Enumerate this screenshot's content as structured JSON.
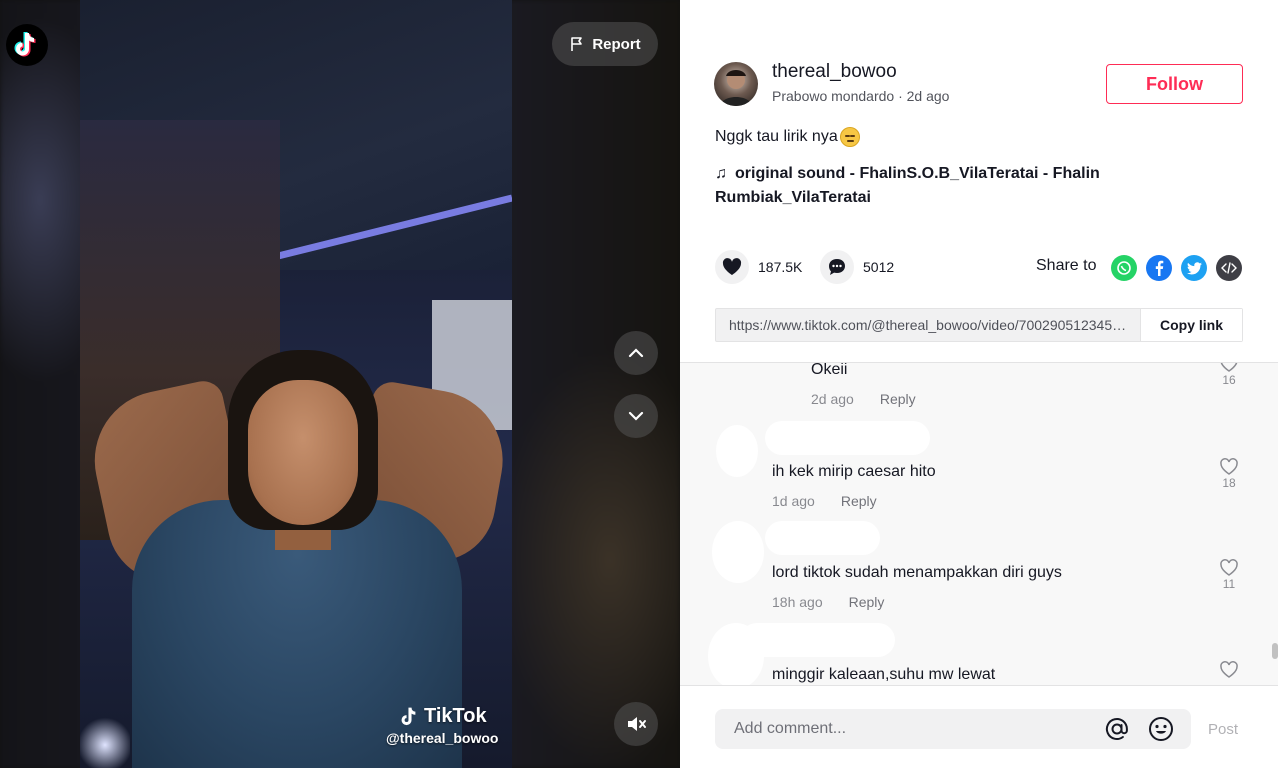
{
  "video": {
    "report_label": "Report",
    "watermark_brand": "TikTok",
    "watermark_handle": "@thereal_bowoo"
  },
  "author": {
    "username": "thereal_bowoo",
    "subtitle": "Prabowo mondardo · 2d ago",
    "follow_label": "Follow"
  },
  "post": {
    "caption": "Nggk tau lirik nya",
    "music": "original sound - FhalinS.O.B_VilaTeratai - Fhalin Rumbiak_VilaTeratai",
    "likes": "187.5K",
    "comments": "5012",
    "share_label": "Share to",
    "link": "https://www.tiktok.com/@thereal_bowoo/video/7002905123456789...",
    "copy_link_label": "Copy link"
  },
  "comments": [
    {
      "text": "Okeii",
      "time": "2d ago",
      "reply": "Reply",
      "likes": "16"
    },
    {
      "text": "ih kek mirip caesar hito",
      "time": "1d ago",
      "reply": "Reply",
      "likes": "18"
    },
    {
      "text": "lord tiktok sudah menampakkan diri guys",
      "time": "18h ago",
      "reply": "Reply",
      "likes": "11"
    },
    {
      "text": "minggir kaleaan,suhu mw lewat",
      "time": "",
      "reply": "",
      "likes": ""
    }
  ],
  "comment_bar": {
    "placeholder": "Add comment...",
    "post_label": "Post"
  },
  "colors": {
    "accent": "#fe2c55",
    "whatsapp": "#25d366",
    "facebook": "#1877f2",
    "twitter": "#1da1f2"
  }
}
